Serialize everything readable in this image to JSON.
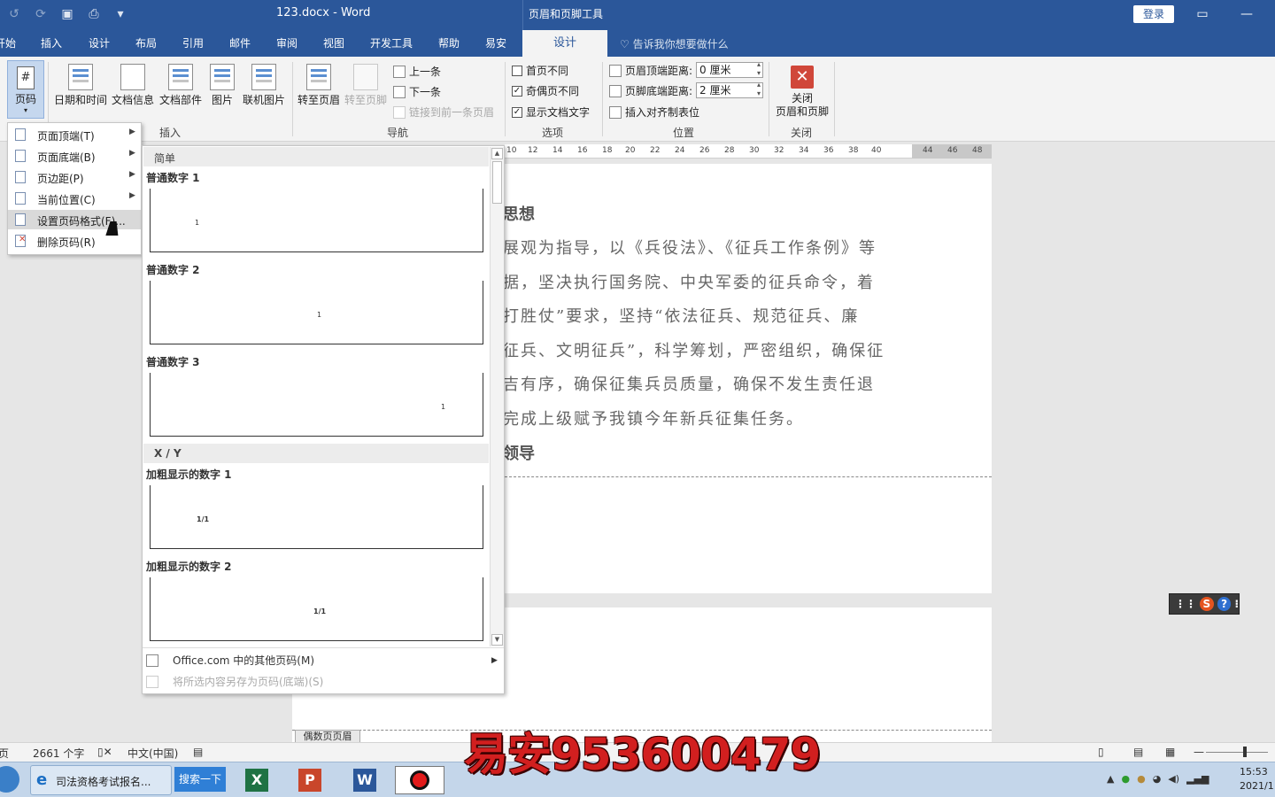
{
  "titlebar": {
    "doc_title": "123.docx  -  Word",
    "tools_title": "页眉和页脚工具",
    "login_label": "登录",
    "restore_icon": "ribbon-display-icon",
    "minimize_icon": "minimize-icon"
  },
  "tabs": [
    {
      "label": "开始"
    },
    {
      "label": "插入"
    },
    {
      "label": "设计"
    },
    {
      "label": "布局"
    },
    {
      "label": "引用"
    },
    {
      "label": "邮件"
    },
    {
      "label": "审阅"
    },
    {
      "label": "视图"
    },
    {
      "label": "开发工具"
    },
    {
      "label": "帮助"
    },
    {
      "label": "易安"
    }
  ],
  "active_tab": "设计",
  "tellme": "告诉我你想要做什么",
  "ribbon": {
    "page_number": "页码",
    "date_time": "日期和时间",
    "doc_info": "文档信息",
    "doc_parts": "文档部件",
    "picture": "图片",
    "online_picture": "联机图片",
    "insert_group": "插入",
    "goto_header": "转至页眉",
    "goto_footer": "转至页脚",
    "previous": "上一条",
    "next": "下一条",
    "link_previous": "链接到前一条页眉",
    "nav_group": "导航",
    "diff_first": "首页不同",
    "diff_odd_even": "奇偶页不同",
    "show_doc_text": "显示文档文字",
    "options_group": "选项",
    "header_top_label": "页眉顶端距离:",
    "header_top_value": "0 厘米",
    "footer_bottom_label": "页脚底端距离:",
    "footer_bottom_value": "2 厘米",
    "insert_align_tab": "插入对齐制表位",
    "position_group": "位置",
    "close_label_1": "关闭",
    "close_label_2": "页眉和页脚",
    "close_group": "关闭"
  },
  "menu": {
    "items": [
      {
        "label": "页面顶端(T)",
        "submenu": true
      },
      {
        "label": "页面底端(B)",
        "submenu": true
      },
      {
        "label": "页边距(P)",
        "submenu": true
      },
      {
        "label": "当前位置(C)",
        "submenu": true
      },
      {
        "label": "设置页码格式(F)...",
        "submenu": false
      },
      {
        "label": "删除页码(R)",
        "submenu": false
      }
    ],
    "side_fragment": "页"
  },
  "gallery": {
    "section_simple": "简单",
    "items_simple": [
      {
        "label": "普通数字 1",
        "glyph": "1"
      },
      {
        "label": "普通数字 2",
        "glyph": "1"
      },
      {
        "label": "普通数字 3",
        "glyph": "1"
      }
    ],
    "section_xy": "X / Y",
    "items_xy": [
      {
        "label": "加粗显示的数字 1",
        "glyph": "1/1"
      },
      {
        "label": "加粗显示的数字 2",
        "glyph": "1/1"
      }
    ],
    "more_office": "Office.com 中的其他页码(M)",
    "save_selection": "将所选内容另存为页码(底端)(S)"
  },
  "ruler": {
    "ticks": [
      "10",
      "12",
      "14",
      "16",
      "18",
      "20",
      "22",
      "24",
      "26",
      "28",
      "30",
      "32",
      "34",
      "36",
      "38",
      "40",
      "44",
      "46",
      "48"
    ]
  },
  "document": {
    "heading1": "思想",
    "lines": [
      "展观为指导，以《兵役法》、《征兵工作条例》等",
      "据，坚决执行国务院、中央军委的征兵命令，着",
      "打胜仗”要求，坚持“依法征兵、规范征兵、廉",
      "征兵、文明征兵”，科学筹划，严密组织，确保征",
      "吉有序，确保征集兵员质量，确保不发生责任退",
      "完成上级赋予我镇今年新兵征集任务。"
    ],
    "heading2": "领导",
    "footer_tag": "偶数页页眉"
  },
  "statusbar": {
    "page_fragment": "页",
    "word_count": "2661 个字",
    "language": "中文(中国)"
  },
  "taskbar": {
    "ie_label": "司法资格考试报名...",
    "search_label": "搜索一下",
    "excel": "X",
    "ppt": "P",
    "word": "W",
    "time": "15:53",
    "date": "2021/1"
  },
  "watermark": "易安953600479",
  "colors": {
    "word_blue": "#2b579a",
    "ribbon_bg": "#f3f3f3",
    "watermark_red": "#d21f1f"
  }
}
